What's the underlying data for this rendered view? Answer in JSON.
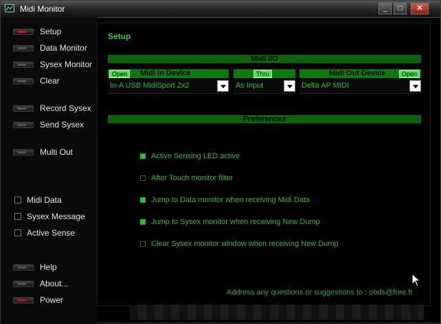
{
  "window": {
    "title": "Midi Monitor",
    "minimize": "_",
    "maximize": "□",
    "close": "✕"
  },
  "sidebar": {
    "nav": [
      {
        "label": "Setup",
        "led": "red"
      },
      {
        "label": "Data Monitor",
        "led": "off"
      },
      {
        "label": "Sysex Monitor",
        "led": "off"
      },
      {
        "label": "Clear",
        "led": "off"
      },
      {
        "label": "Record Sysex",
        "led": "off"
      },
      {
        "label": "Send Sysex",
        "led": "off"
      },
      {
        "label": "Multi Out",
        "led": "off"
      }
    ],
    "checks": [
      {
        "label": "Midi Data"
      },
      {
        "label": "Sysex Message"
      },
      {
        "label": "Active Sense"
      }
    ],
    "bottom": [
      {
        "label": "Help",
        "led": "off"
      },
      {
        "label": "About...",
        "led": "off"
      },
      {
        "label": "Power",
        "led": "red"
      }
    ]
  },
  "setup": {
    "title": "Setup",
    "midi_io_header": "Midi I/O",
    "midi_in": {
      "header": "Midi In Device",
      "open_label": "Open",
      "value": "In-A USB MidiSport 2x2"
    },
    "thru": {
      "label": "Thru",
      "value": "As Input"
    },
    "midi_out": {
      "header": "Midi Out Device",
      "open_label": "Open",
      "value": "Delta AP MIDI"
    },
    "preferences_header": "Preferences",
    "preferences": [
      {
        "label": "Active Sensing LED active",
        "checked": true
      },
      {
        "label": "After Touch monitor filter",
        "checked": false
      },
      {
        "label": "Jump to Data monitor when receiving Midi Data",
        "checked": true
      },
      {
        "label": "Jump to Sysex monitor when receiving New Dump",
        "checked": true
      },
      {
        "label": "Clear Sysex monitor window when receiving New Dump",
        "checked": false
      }
    ],
    "footer": "Address any questions or suggestions to :  obds@free.fr"
  },
  "colors": {
    "accent_green": "#0a640a",
    "text_green": "#33bb33",
    "led_red": "#d01010"
  }
}
